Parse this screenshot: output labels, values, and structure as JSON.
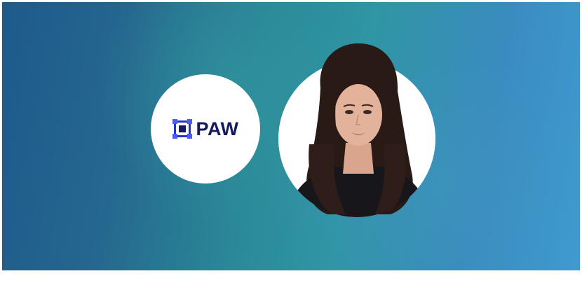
{
  "brand": {
    "name": "PAW",
    "logo_icon": "paw-frame-icon",
    "text_color": "#141a5c",
    "mark_color": "#3b4ef0"
  },
  "portrait": {
    "icon": "person-portrait"
  },
  "colors": {
    "background_start": "#1e5a8c",
    "background_mid": "#2a8a98",
    "background_end": "#3e9bd0"
  }
}
